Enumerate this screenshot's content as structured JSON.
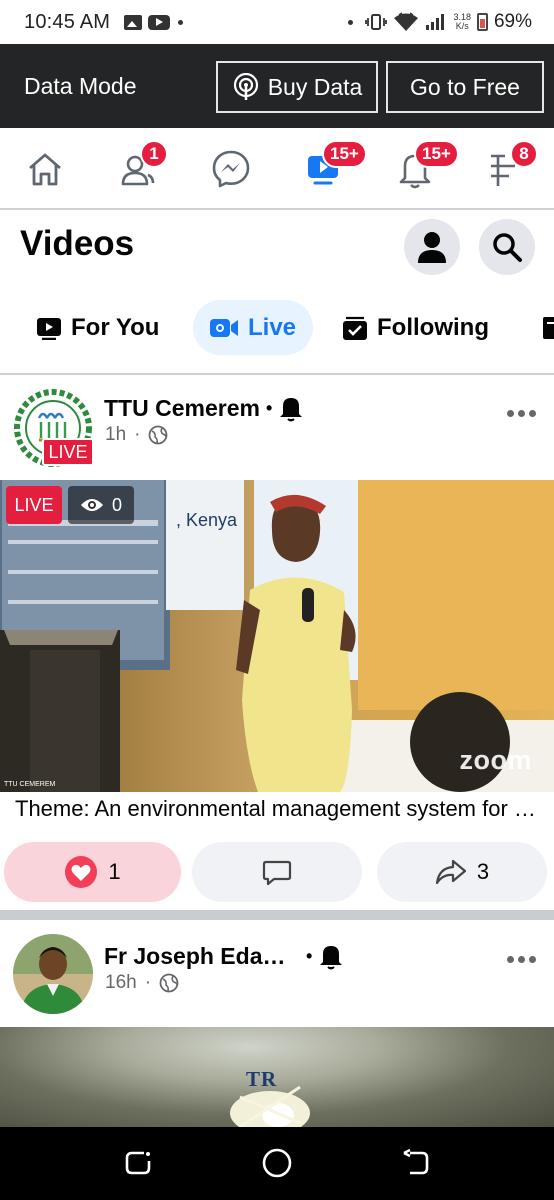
{
  "status_bar": {
    "time": "10:45 AM",
    "speed_value": "3.18",
    "speed_unit": "K/s",
    "battery": "69%"
  },
  "data_mode": {
    "label": "Data Mode",
    "buy_label": "Buy Data",
    "free_label": "Go to Free"
  },
  "nav": {
    "items": [
      {
        "icon": "home-icon"
      },
      {
        "icon": "friends-icon",
        "badge": "1"
      },
      {
        "icon": "messenger-icon"
      },
      {
        "icon": "video-icon",
        "badge": "15+",
        "active": true
      },
      {
        "icon": "bell-icon",
        "badge": "15+"
      },
      {
        "icon": "menu-icon",
        "badge": "8"
      }
    ],
    "accent": "#1877f2",
    "badge_color": "#e41e3f"
  },
  "header": {
    "title": "Videos"
  },
  "tabs": [
    {
      "label": "For You",
      "icon": "play-icon"
    },
    {
      "label": "Live",
      "icon": "live-camera-icon",
      "active": true
    },
    {
      "label": "Following",
      "icon": "saved-icon"
    }
  ],
  "posts": [
    {
      "author": "TTU Cemerem",
      "time": "1h",
      "avatar_live": "LIVE",
      "live_tag": "LIVE",
      "viewers": "0",
      "watermark": "zoom",
      "video_corner_text": "TTU CEMEREM",
      "caption": "Theme: An environmental management system for sustainable development",
      "reactions": "1",
      "shares": "3"
    },
    {
      "author": "Fr Joseph Edamaram",
      "time": "16h",
      "video_text": "TR"
    }
  ]
}
